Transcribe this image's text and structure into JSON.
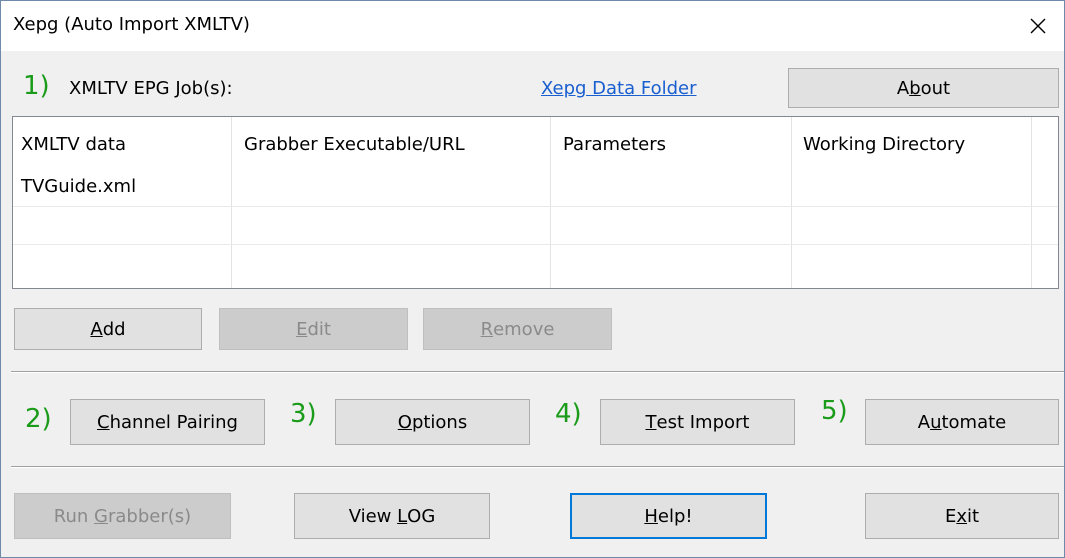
{
  "window": {
    "title": "Xepg (Auto Import XMLTV)",
    "close_icon": "close-icon"
  },
  "section1": {
    "step": "1)",
    "label_pre": "XMLTV EPG ",
    "label_acc": "J",
    "label_post": "ob(s):",
    "link": "Xepg Data Folder",
    "about_pre": "A",
    "about_acc": "b",
    "about_post": "out"
  },
  "table": {
    "headers": [
      "XMLTV data",
      "Grabber Executable/URL",
      "Parameters",
      "Working Directory"
    ],
    "rows": [
      [
        "TVGuide.xml",
        "",
        "",
        ""
      ],
      [
        "",
        "",
        "",
        ""
      ],
      [
        "",
        "",
        "",
        ""
      ]
    ]
  },
  "job_buttons": {
    "add_acc": "A",
    "add_post": "dd",
    "edit_acc": "E",
    "edit_post": "dit",
    "remove_acc": "R",
    "remove_post": "emove"
  },
  "steps": {
    "s2": "2)",
    "s3": "3)",
    "s4": "4)",
    "s5": "5)",
    "channel_acc": "C",
    "channel_post": "hannel Pairing",
    "options_acc": "O",
    "options_post": "ptions",
    "test_acc": "T",
    "test_post": "est Import",
    "automate_pre": "A",
    "automate_acc": "u",
    "automate_post": "tomate"
  },
  "bottom": {
    "run_pre": "Run ",
    "run_acc": "G",
    "run_post": "rabber(s)",
    "log_pre": "View ",
    "log_acc": "L",
    "log_post": "OG",
    "help_acc": "H",
    "help_post": "elp!",
    "exit_pre": "E",
    "exit_acc": "x",
    "exit_post": "it"
  }
}
